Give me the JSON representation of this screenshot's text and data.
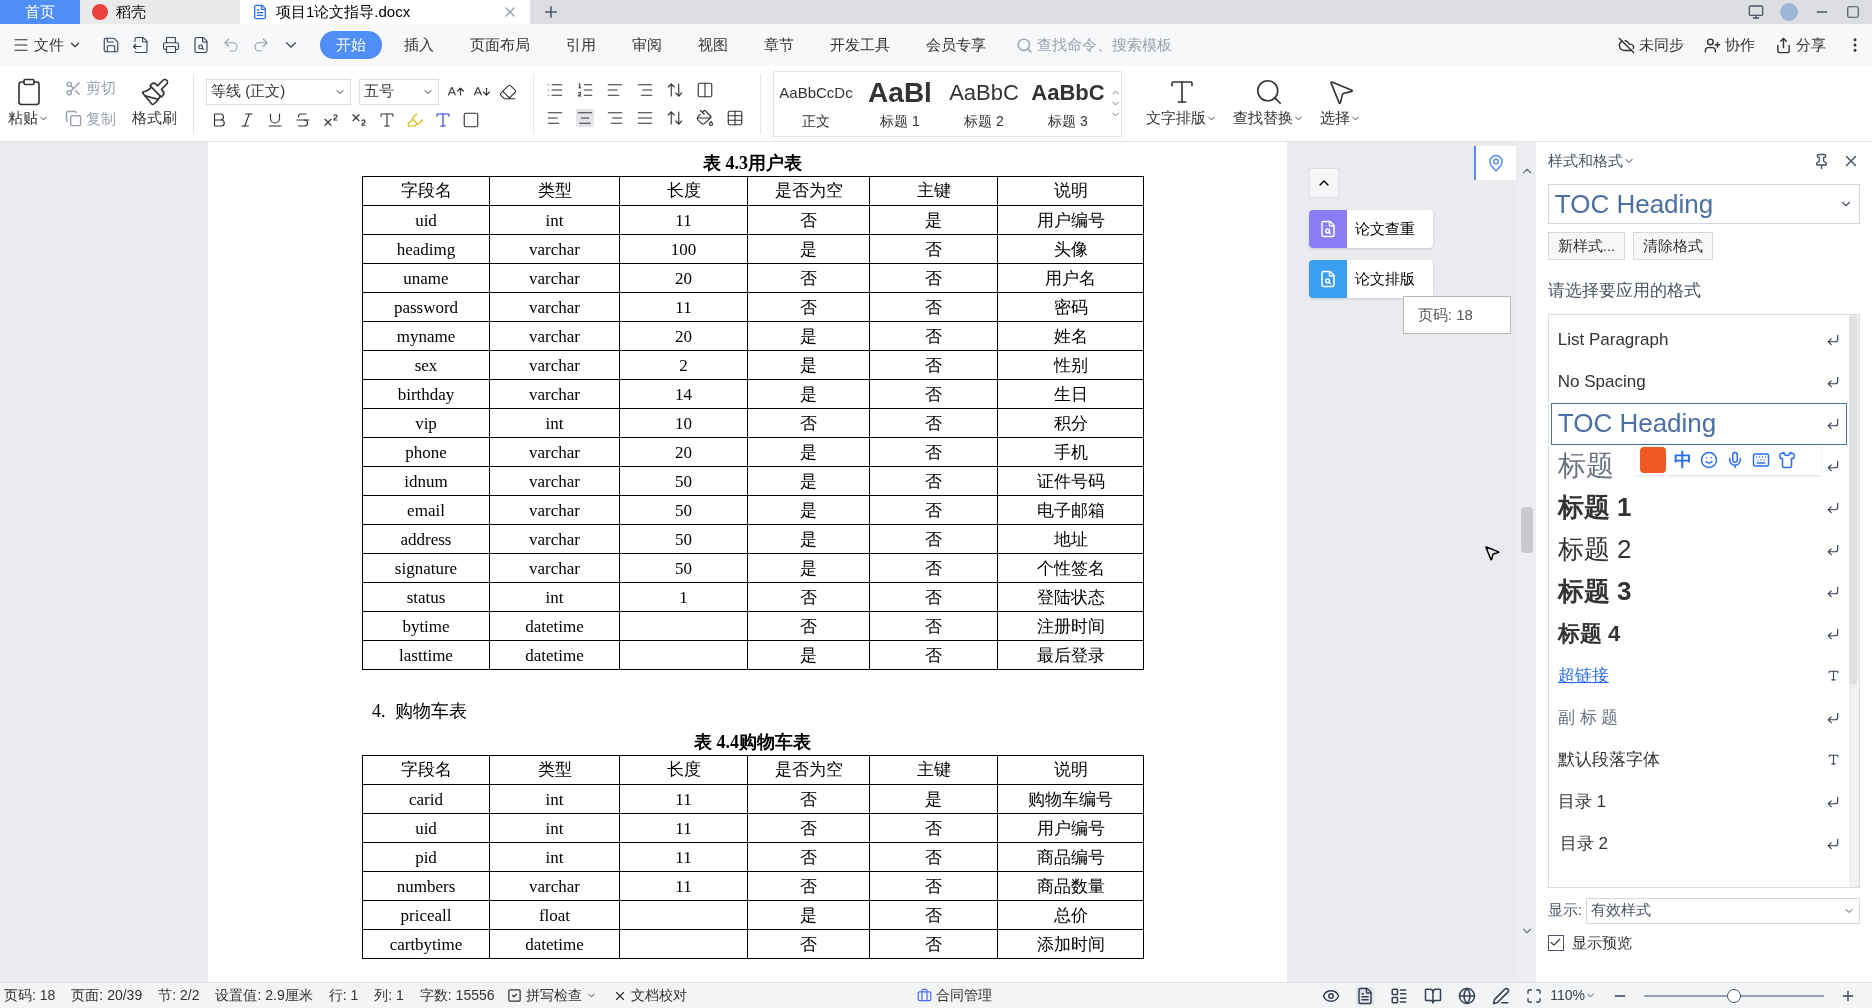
{
  "title_tabs": [
    {
      "label": "首页",
      "kind": "home",
      "selected": false
    },
    {
      "label": "稻壳",
      "kind": "app",
      "selected": false
    },
    {
      "label": "项目1论文指导.docx",
      "kind": "doc",
      "selected": true
    }
  ],
  "menu": {
    "file": "文件",
    "tabs": [
      {
        "label": "开始",
        "selected": true
      },
      {
        "label": "插入",
        "selected": false
      },
      {
        "label": "页面布局",
        "selected": false
      },
      {
        "label": "引用",
        "selected": false
      },
      {
        "label": "审阅",
        "selected": false
      },
      {
        "label": "视图",
        "selected": false
      },
      {
        "label": "章节",
        "selected": false
      },
      {
        "label": "开发工具",
        "selected": false
      },
      {
        "label": "会员专享",
        "selected": false
      }
    ],
    "search": {
      "placeholder": "查找命令、搜索模板"
    },
    "actions": [
      {
        "label": "未同步",
        "kind": "sync"
      },
      {
        "label": "协作",
        "kind": "collab"
      },
      {
        "label": "分享",
        "kind": "share"
      }
    ]
  },
  "ribbon": {
    "paste": "粘贴",
    "cut": {
      "label": "剪切",
      "disabled": true
    },
    "copy": {
      "label": "复制",
      "disabled": true
    },
    "format_painter": "格式刷",
    "font": "等线 (正文)",
    "size": "五号",
    "styles": [
      {
        "preview": "AaBbCcDc",
        "label": "正文",
        "kind": "body"
      },
      {
        "preview": "AaBl",
        "label": "标题 1",
        "kind": "h1"
      },
      {
        "preview": "AaBbC",
        "label": "标题 2",
        "kind": "h2"
      },
      {
        "preview": "AaBbC",
        "label": "标题 3",
        "kind": "h3"
      }
    ],
    "tools": [
      {
        "label": "文字排版",
        "kind": "layout"
      },
      {
        "label": "查找替换",
        "kind": "find"
      },
      {
        "label": "选择",
        "kind": "select"
      }
    ]
  },
  "document": {
    "caption_1": "表 4.3用户表",
    "table_1": {
      "columns": [
        "字段名",
        "类型",
        "长度",
        "是否为空",
        "主键",
        "说明"
      ],
      "rows": [
        [
          "uid",
          "int",
          "11",
          "否",
          "是",
          "用户编号"
        ],
        [
          "headimg",
          "varchar",
          "100",
          "是",
          "否",
          "头像"
        ],
        [
          "uname",
          "varchar",
          "20",
          "否",
          "否",
          "用户名"
        ],
        [
          "password",
          "varchar",
          "11",
          "否",
          "否",
          "密码"
        ],
        [
          "myname",
          "varchar",
          "20",
          "是",
          "否",
          "姓名"
        ],
        [
          "sex",
          "varchar",
          "2",
          "是",
          "否",
          "性别"
        ],
        [
          "birthday",
          "varchar",
          "14",
          "是",
          "否",
          "生日"
        ],
        [
          "vip",
          "int",
          "10",
          "否",
          "否",
          "积分"
        ],
        [
          "phone",
          "varchar",
          "20",
          "是",
          "否",
          "手机"
        ],
        [
          "idnum",
          "varchar",
          "50",
          "是",
          "否",
          "证件号码"
        ],
        [
          "email",
          "varchar",
          "50",
          "是",
          "否",
          "电子邮箱"
        ],
        [
          "address",
          "varchar",
          "50",
          "是",
          "否",
          "地址"
        ],
        [
          "signature",
          "varchar",
          "50",
          "是",
          "否",
          "个性签名"
        ],
        [
          "status",
          "int",
          "1",
          "否",
          "否",
          "登陆状态"
        ],
        [
          "bytime",
          "datetime",
          null,
          "否",
          "否",
          "注册时间"
        ],
        [
          "lasttime",
          "datetime",
          null,
          "是",
          "否",
          "最后登录"
        ]
      ]
    },
    "heading": "4.  购物车表",
    "caption_2": "表 4.4购物车表",
    "table_2": {
      "columns": [
        "字段名",
        "类型",
        "长度",
        "是否为空",
        "主键",
        "说明"
      ],
      "rows": [
        [
          "carid",
          "int",
          "11",
          "否",
          "是",
          "购物车编号"
        ],
        [
          "uid",
          "int",
          "11",
          "否",
          "否",
          "用户编号"
        ],
        [
          "pid",
          "int",
          "11",
          "否",
          "否",
          "商品编号"
        ],
        [
          "numbers",
          "varchar",
          "11",
          "否",
          "否",
          "商品数量"
        ],
        [
          "priceall",
          "float",
          null,
          "是",
          "否",
          "总价"
        ],
        [
          "cartbytime",
          "datetime",
          null,
          "否",
          "否",
          "添加时间"
        ]
      ]
    }
  },
  "side_buttons": [
    {
      "label": "论文查重",
      "color": "#8b7cf6"
    },
    {
      "label": "论文排版",
      "color": "#3ba0f2"
    }
  ],
  "page_tooltip": "页码: 18",
  "styles_panel": {
    "title": "样式和格式",
    "current": "TOC Heading",
    "buttons": [
      "新样式...",
      "清除格式"
    ],
    "prompt": "请选择要应用的格式",
    "items": [
      {
        "label": "List Paragraph",
        "kind": "plain",
        "character_style": false,
        "selected": false
      },
      {
        "label": "No Spacing",
        "kind": "plain",
        "character_style": false,
        "selected": false
      },
      {
        "label": "TOC Heading",
        "kind": "toc",
        "character_style": false,
        "selected": true
      },
      {
        "label": "标题",
        "kind": "title",
        "character_style": false,
        "selected": false
      },
      {
        "label": "标题  1",
        "kind": "h1",
        "character_style": false,
        "selected": false
      },
      {
        "label": "标题  2",
        "kind": "h2",
        "character_style": false,
        "selected": false
      },
      {
        "label": "标题  3",
        "kind": "h3",
        "character_style": false,
        "selected": false
      },
      {
        "label": "标题  4",
        "kind": "h4",
        "character_style": false,
        "selected": false
      },
      {
        "label": "超链接",
        "kind": "link",
        "character_style": true,
        "selected": false
      },
      {
        "label": "副 标 题",
        "kind": "subtitle",
        "character_style": false,
        "selected": false
      },
      {
        "label": "默认段落字体",
        "kind": "plain",
        "character_style": true,
        "selected": false
      },
      {
        "label": "目录  1",
        "kind": "toc1",
        "character_style": false,
        "selected": false
      },
      {
        "label": "目录  2",
        "kind": "toc2",
        "character_style": false,
        "selected": false
      }
    ],
    "show_label": "显示:",
    "show_value": "有效样式",
    "preview": {
      "label": "显示预览",
      "checked": true
    }
  },
  "ime": {
    "label": "中"
  },
  "status_bar": {
    "items": [
      "页码: 18",
      "页面: 20/39",
      "节: 2/2",
      "设置值: 2.9厘米",
      "行: 1",
      "列: 1",
      "字数: 15556"
    ],
    "spell": "拼写检查",
    "proof": "文档校对",
    "contract": "合同管理",
    "zoom": "110%",
    "zoom_slider": {
      "level": 0.5
    }
  }
}
